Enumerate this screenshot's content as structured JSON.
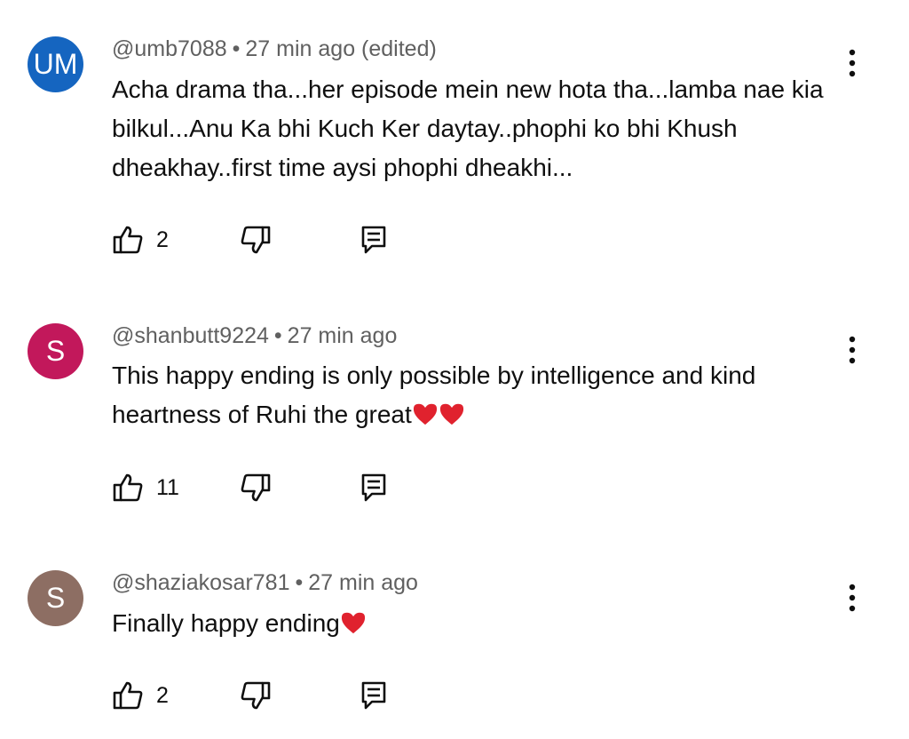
{
  "comments": [
    {
      "avatar_initials": "UM",
      "avatar_color": "#1565c0",
      "author": "@umb7088",
      "separator": "•",
      "time": "27 min ago (edited)",
      "text": "Acha drama tha...her episode mein new hota tha...lamba nae kia bilkul...Anu Ka bhi Kuch Ker daytay..phophi ko bhi Khush dheakhay..first time aysi phophi dheakhi...",
      "hearts": 0,
      "likes": "2"
    },
    {
      "avatar_initials": "S",
      "avatar_color": "#c2185b",
      "author": "@shanbutt9224",
      "separator": "•",
      "time": "27 min ago",
      "text": "This happy ending is only possible by intelligence and kind heartness of Ruhi the great",
      "hearts": 2,
      "likes": "11"
    },
    {
      "avatar_initials": "S",
      "avatar_color": "#8d6e63",
      "author": "@shaziakosar781",
      "separator": "•",
      "time": "27 min ago",
      "text": "Finally happy ending",
      "hearts": 1,
      "likes": "2"
    }
  ],
  "icons": {
    "like": "thumbs-up-icon",
    "dislike": "thumbs-down-icon",
    "reply": "reply-icon",
    "more": "more-vertical-icon",
    "heart": "red-heart-emoji"
  },
  "colors": {
    "text": "#0f0f0f",
    "meta": "#606060",
    "heart": "#e0222e"
  }
}
